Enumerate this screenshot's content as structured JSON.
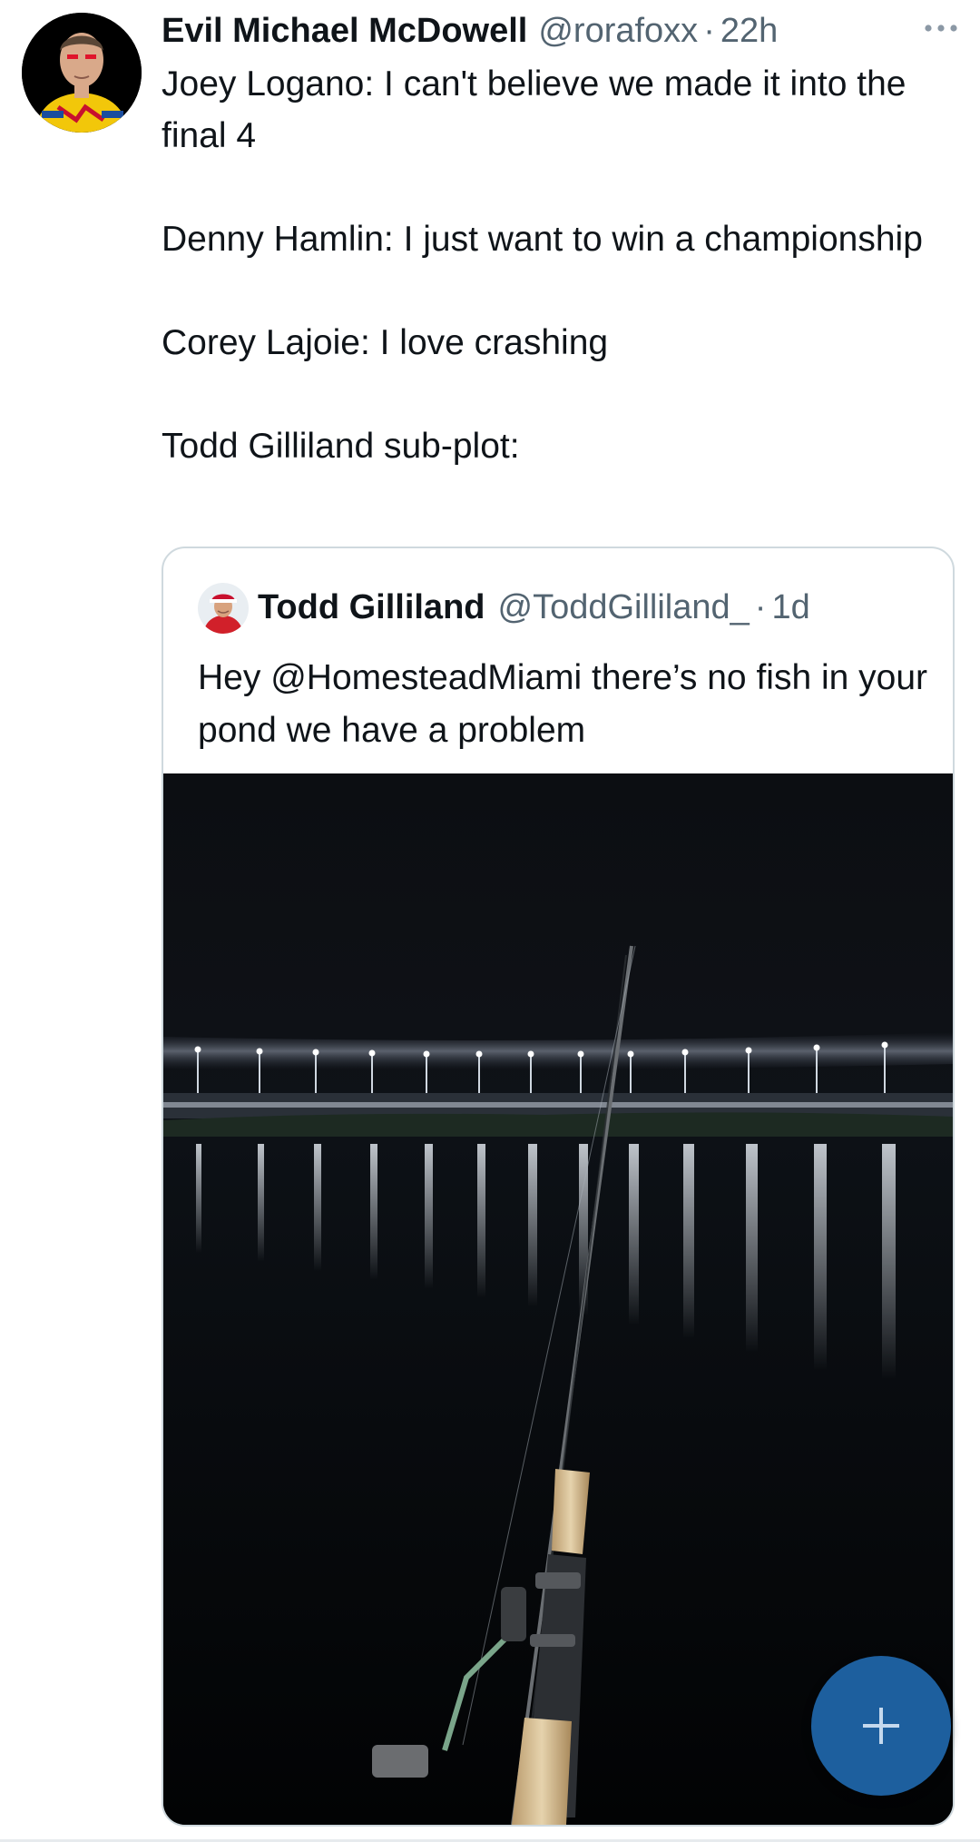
{
  "tweet": {
    "display_name": "Evil Michael McDowell",
    "handle": "@rorafoxx",
    "separator": "·",
    "time": "22h",
    "text_lines": [
      "Joey Logano: I can't believe we made it into the final 4",
      "Denny Hamlin: I just want to win a championship",
      "Corey Lajoie: I love crashing",
      "Todd Gilliland sub-plot:"
    ],
    "more_icon": "more-horizontal-icon"
  },
  "quote": {
    "display_name": "Todd Gilliland",
    "handle": "@ToddGilliland_",
    "separator": "·",
    "time": "1d",
    "text": "Hey @HomesteadMiami there’s no fish in your pond we have a problem"
  },
  "fab": {
    "icon": "plus-icon"
  },
  "colors": {
    "text_primary": "#0f1419",
    "text_secondary": "#536471",
    "card_border": "#cfd9de",
    "fab_background": "#1d5f9e"
  }
}
